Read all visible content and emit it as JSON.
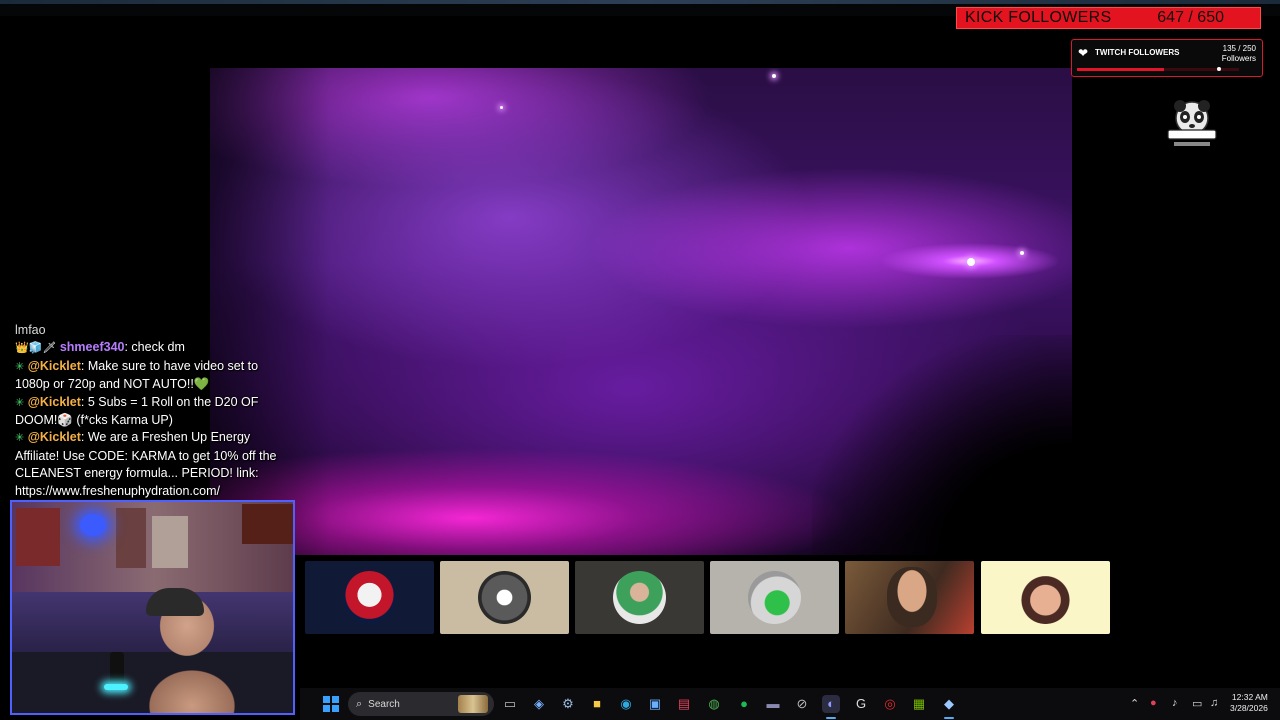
{
  "overlay": {
    "kick_followers": {
      "label": "KICK FOLLOWERS",
      "count": "647 / 650",
      "progress": 0.995
    },
    "twitch_followers": {
      "label": "TWITCH FOLLOWERS",
      "count": "135 / 250",
      "unit": "Followers",
      "progress": 0.54
    },
    "logo_icon": "panda-logo-icon"
  },
  "chat": {
    "lines": [
      {
        "user": "",
        "text": "lmfao"
      },
      {
        "badges": "👑🧊🗡",
        "user": "shmeef340",
        "text": ": check dm"
      },
      {
        "badges": "✳",
        "user": "@Kicklet",
        "text": ": Make sure to have video set to 1080p or 720p and NOT AUTO!!💚"
      },
      {
        "badges": "✳",
        "user": "@Kicklet",
        "text": ": 5 Subs = 1 Roll on the D20 OF DOOM!🎲 (f*cks Karma UP)"
      },
      {
        "badges": "✳",
        "user": "@Kicklet",
        "text": ": We are a Freshen Up Energy Affiliate! Use CODE: KARMA to get 10% off the CLEANEST energy formula... PERIOD! link: https://www.freshenuphydration.com/"
      }
    ]
  },
  "taskbar": {
    "search_placeholder": "Search",
    "time": "12:32 AM",
    "date": "3/28/2026",
    "icons": [
      "windows-start-icon",
      "search-icon",
      "file-explorer-icon",
      "copilot-icon",
      "settings-icon",
      "folder-icon",
      "edge-icon",
      "store-icon",
      "sticky-icon",
      "chrome-icon",
      "spotify-icon",
      "media-icon",
      "steam-tool-icon",
      "discord-icon",
      "gamer-icon",
      "red-app-icon",
      "nvidia-icon",
      "steam-icon"
    ]
  },
  "colors": {
    "kick_red": "#e3141f",
    "twitch_red": "#d41c2c",
    "chat_purple": "#b87dff",
    "chat_orange": "#f4b045"
  }
}
